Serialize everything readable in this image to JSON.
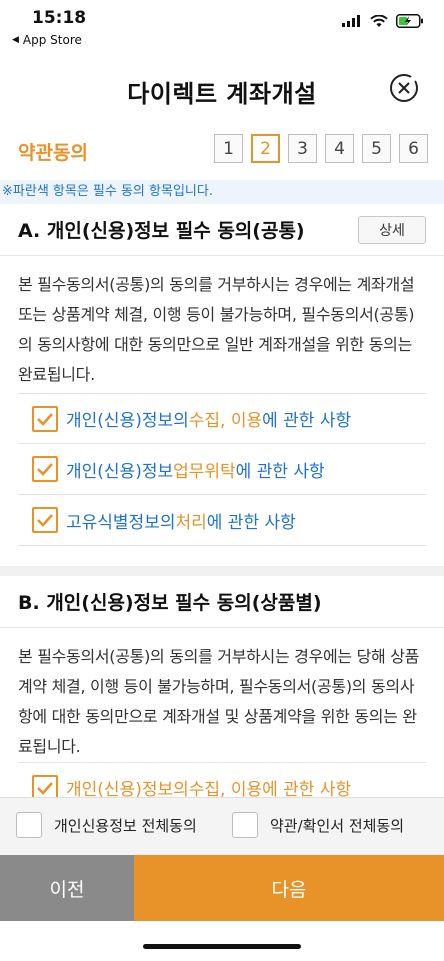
{
  "status": {
    "time": "15:18",
    "back_app": "App Store"
  },
  "header": {
    "title": "다이렉트 계좌개설"
  },
  "steps": {
    "label": "약관동의",
    "items": [
      "1",
      "2",
      "3",
      "4",
      "5",
      "6"
    ],
    "active": "2"
  },
  "notice": "※파란색 항목은 필수 동의 항목입니다.",
  "section_a": {
    "title": "A. 개인(신용)정보 필수 동의(공통)",
    "detail_label": "상세",
    "description": "본 필수동의서(공통)의 동의를 거부하시는 경우에는 계좌개설 또는 상품계약 체결, 이행 등이 불가능하며, 필수동의서(공통)의 동의사항에 대한 동의만으로 일반 계좌개설을 위한 동의는 완료됩니다.",
    "items": [
      {
        "p1": "개인(신용)정보의 ",
        "p2": "수집, 이용",
        "p3": "에 관한 사항"
      },
      {
        "p1": "개인(신용)정보 ",
        "p2": "업무위탁",
        "p3": "에 관한 사항"
      },
      {
        "p1": "고유식별정보의 ",
        "p2": "처리",
        "p3": "에 관한 사항"
      }
    ]
  },
  "section_b": {
    "title": "B. 개인(신용)정보 필수 동의(상품별)",
    "description": "본 필수동의서(공통)의 동의를 거부하시는 경우에는 당해 상품계약 체결, 이행 등이 불가능하며, 필수동의서(공통)의 동의사항에 대한 동의만으로 계좌개설 및 상품계약을 위한 동의는 완료됩니다.",
    "items": [
      {
        "p1": "개인(신용)정보의 ",
        "p2": "수집, 이용",
        "p3": "에 관한 사항"
      }
    ]
  },
  "bottom": {
    "agree_personal": "개인신용정보 전체동의",
    "agree_terms": "약관/확인서 전체동의"
  },
  "nav": {
    "prev": "이전",
    "next": "다음"
  },
  "colors": {
    "accent": "#e8932a",
    "blue": "#1e73d2",
    "prev_bg": "#8a8a8a"
  }
}
